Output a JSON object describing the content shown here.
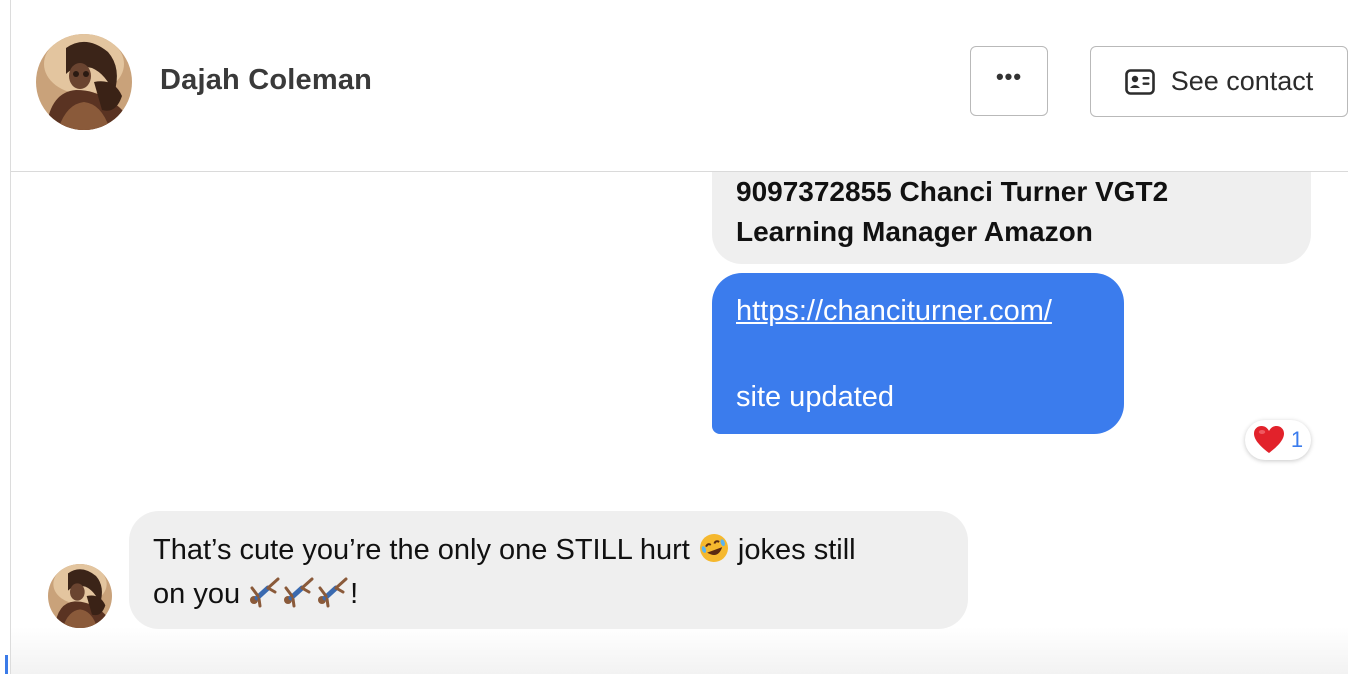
{
  "header": {
    "contact_name": "Dajah Coleman",
    "more_label": "•••",
    "see_contact_label": "See contact",
    "avatar_icon": "contact-photo",
    "see_contact_icon": "contact-card-icon"
  },
  "messages": {
    "outgoing_text": {
      "line1": "9097372855 Chanci Turner VGT2",
      "line2": "Learning Manager Amazon"
    },
    "outgoing_link": {
      "link": "https://chanciturner.com/",
      "text": "site updated",
      "reaction": {
        "icon": "heart-icon",
        "count": "1"
      }
    },
    "incoming": {
      "line1_before_emoji": "That’s cute you’re the only one STILL hurt ",
      "line1_after_emoji": " jokes still",
      "line2_before_emoji": "on you ",
      "line2_after_emoji": "!",
      "emojis": [
        "rolling-laughing-emoji",
        "cartwheel-emoji",
        "cartwheel-emoji",
        "cartwheel-emoji"
      ]
    }
  },
  "colors": {
    "outgoing_bubble": "#3b7ced",
    "gray_bubble": "#efefef",
    "reaction_count": "#3b7ced"
  }
}
